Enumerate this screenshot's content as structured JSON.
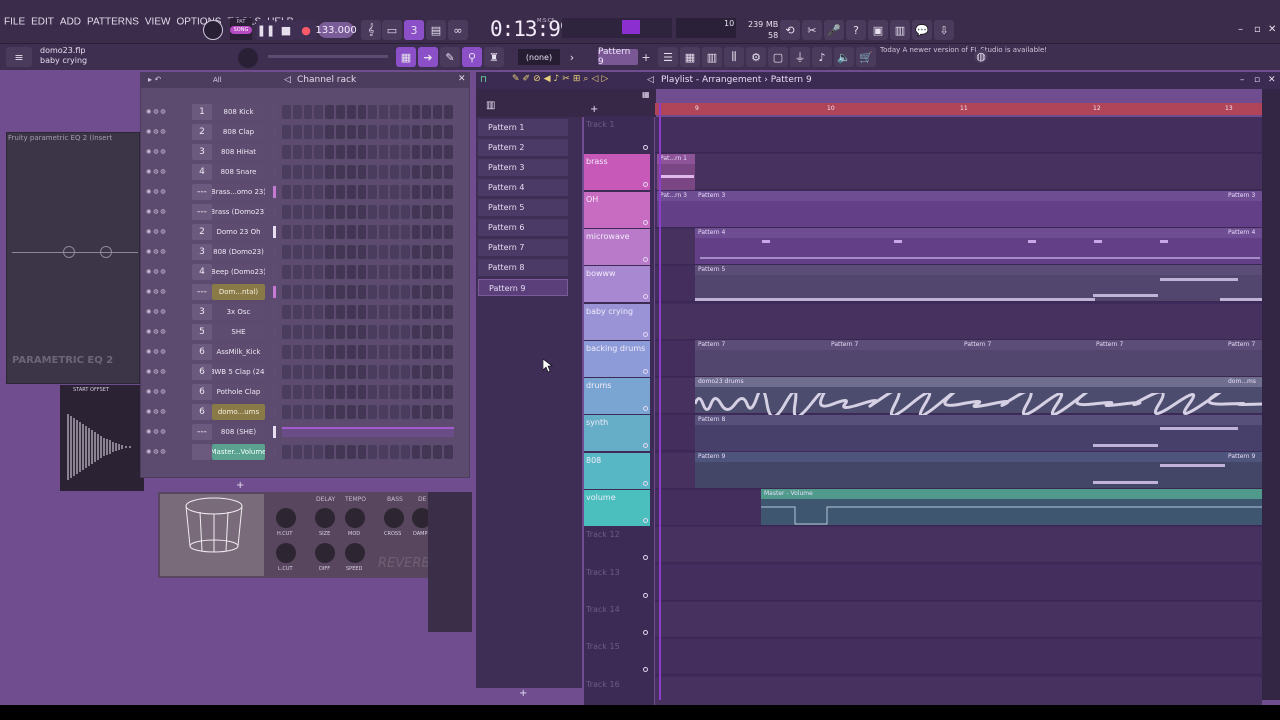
{
  "menu": [
    "FILE",
    "EDIT",
    "ADD",
    "PATTERNS",
    "VIEW",
    "OPTIONS",
    "TOOLS",
    "HELP"
  ],
  "transport": {
    "mode_pat": "PAT",
    "mode_song": "SONG",
    "tempo": "133.000",
    "time": "0:13:99",
    "time_unit": "M:S:CS"
  },
  "cpu": {
    "value": "10",
    "mem": "239 MB",
    "voices": "58"
  },
  "project": {
    "file": "domo23.flp",
    "hint": "baby crying"
  },
  "toolbar": {
    "snap": "(none)",
    "pattern": "Pattern 9"
  },
  "news": {
    "day": "Today",
    "text": "A newer version of FL Studio is available!"
  },
  "eq": {
    "title": "Fruity parametric EQ 2 (Insert",
    "brand": "PARAMETRIC EQ 2"
  },
  "sampler": {
    "label": "START OFFSET"
  },
  "reverb": {
    "knobs": [
      "H.CUT",
      "SIZE",
      "MOD",
      "CROSS",
      "DAMP",
      "L.CUT",
      "DIFF",
      "SPEED"
    ],
    "heads": [
      "DELAY",
      "TEMPO",
      "BASS",
      "DE"
    ],
    "brand": "REVERB"
  },
  "channel_rack": {
    "title": "Channel rack",
    "filter": "All",
    "channels": [
      {
        "num": "1",
        "name": "808 Kick",
        "style": ""
      },
      {
        "num": "2",
        "name": "808 Clap",
        "style": ""
      },
      {
        "num": "3",
        "name": "808 HiHat",
        "style": ""
      },
      {
        "num": "4",
        "name": "808 Snare",
        "style": ""
      },
      {
        "num": "---",
        "name": "Brass...omo 23)",
        "style": ""
      },
      {
        "num": "---",
        "name": "Brass (Domo23)",
        "style": ""
      },
      {
        "num": "2",
        "name": "Domo 23 Oh",
        "style": ""
      },
      {
        "num": "3",
        "name": "808 (Domo23)",
        "style": ""
      },
      {
        "num": "4",
        "name": "Beep (Domo23)",
        "style": ""
      },
      {
        "num": "---",
        "name": "Dom...ntal)",
        "style": "hi"
      },
      {
        "num": "3",
        "name": "3x Osc",
        "style": ""
      },
      {
        "num": "5",
        "name": "SHE",
        "style": ""
      },
      {
        "num": "6",
        "name": "AssMilk_Kick",
        "style": ""
      },
      {
        "num": "6",
        "name": "BWB 5 Clap (24)",
        "style": ""
      },
      {
        "num": "6",
        "name": "Pothole Clap",
        "style": ""
      },
      {
        "num": "6",
        "name": "domo...ums",
        "style": "hi"
      },
      {
        "num": "---",
        "name": "808 (SHE)",
        "style": "bar"
      },
      {
        "num": "",
        "name": "Master...Volume",
        "style": "teal"
      }
    ],
    "add": "+"
  },
  "picker": {
    "patterns": [
      "Pattern 1",
      "Pattern 2",
      "Pattern 3",
      "Pattern 4",
      "Pattern 5",
      "Pattern 6",
      "Pattern 7",
      "Pattern 8",
      "Pattern 9"
    ],
    "add": "+"
  },
  "playlist": {
    "title": "Playlist - Arrangement",
    "pattern": "Pattern 9",
    "bars": [
      "9",
      "10",
      "11",
      "12",
      "13"
    ],
    "tracks": [
      {
        "name": "Track 1",
        "color": "#3c2c55"
      },
      {
        "name": "brass",
        "color": "#c75ab8"
      },
      {
        "name": "OH",
        "color": "#c76cc0"
      },
      {
        "name": "microwave",
        "color": "#b97ac9"
      },
      {
        "name": "bowww",
        "color": "#a889d1"
      },
      {
        "name": "baby crying",
        "color": "#9a94d6"
      },
      {
        "name": "backing drums",
        "color": "#8d9bd8"
      },
      {
        "name": "drums",
        "color": "#7aa4d2"
      },
      {
        "name": "synth",
        "color": "#66aec8"
      },
      {
        "name": "808",
        "color": "#57b7c4"
      },
      {
        "name": "volume",
        "color": "#4bbfbe"
      },
      {
        "name": "Track 12",
        "color": "#3c2c55"
      },
      {
        "name": "Track 13",
        "color": "#3c2c55"
      },
      {
        "name": "Track 14",
        "color": "#3c2c55"
      },
      {
        "name": "Track 15",
        "color": "#3c2c55"
      },
      {
        "name": "Track 16",
        "color": "#3c2c55"
      }
    ],
    "clips": {
      "brass": "Pat...rn 1",
      "oh": "Pat...rn 3",
      "oh2": "Pattern 3",
      "oh3": "Pattern 3",
      "mw": "Pattern 4",
      "mw2": "Pattern 4",
      "bow": "Pattern 5",
      "back": [
        "Pattern 7",
        "Pattern 7",
        "Pattern 7",
        "Pattern 7",
        "Pattern 7"
      ],
      "drums": "domo23 drums",
      "drums2": "dom...ms",
      "synth": "Pattern 8",
      "p9": "Pattern 9",
      "p9b": "Pattern 9",
      "vol": "Master - Volume"
    }
  }
}
